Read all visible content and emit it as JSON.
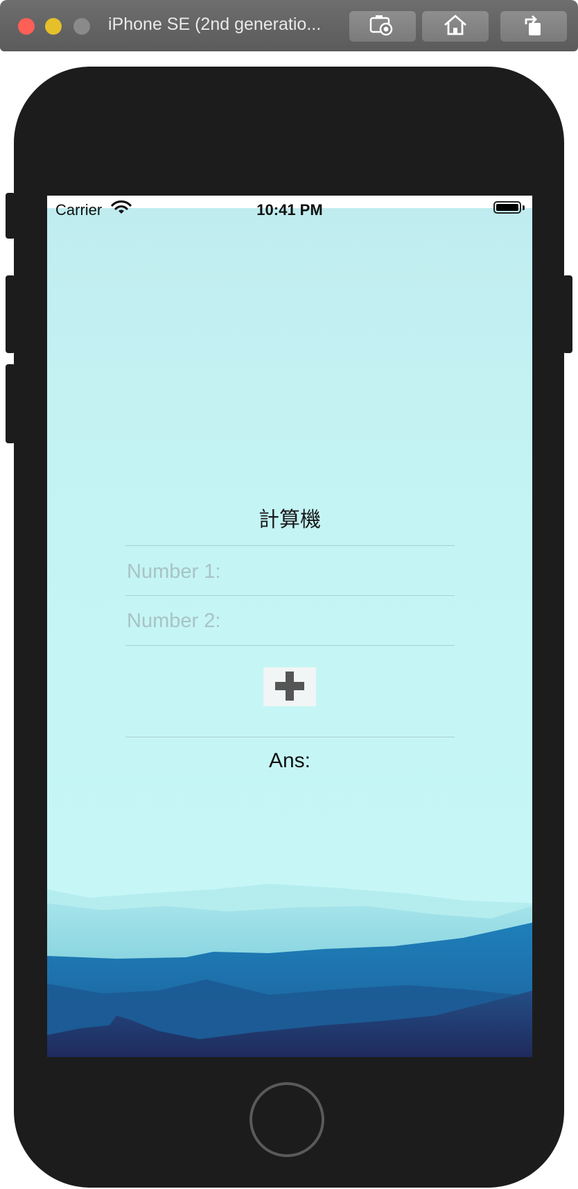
{
  "window": {
    "title": "iPhone SE (2nd generatio...",
    "buttons": [
      "screenshot-icon",
      "home-icon",
      "rotate-icon"
    ]
  },
  "status_bar": {
    "carrier": "Carrier",
    "time": "10:41 PM",
    "battery_level": 1.0
  },
  "app": {
    "title": "計算機",
    "number1_placeholder": "Number 1:",
    "number2_placeholder": "Number 2:",
    "operator_icon": "plus-icon",
    "answer_label": "Ans:"
  },
  "colors": {
    "sky_top": "#c0ecef",
    "sky_bottom": "#c6f8f7",
    "mountain_dark": "#1f3566",
    "mountain_mid": "#1b6aa6",
    "mountain_light": "#65c6d6",
    "device": "#1c1c1c"
  }
}
